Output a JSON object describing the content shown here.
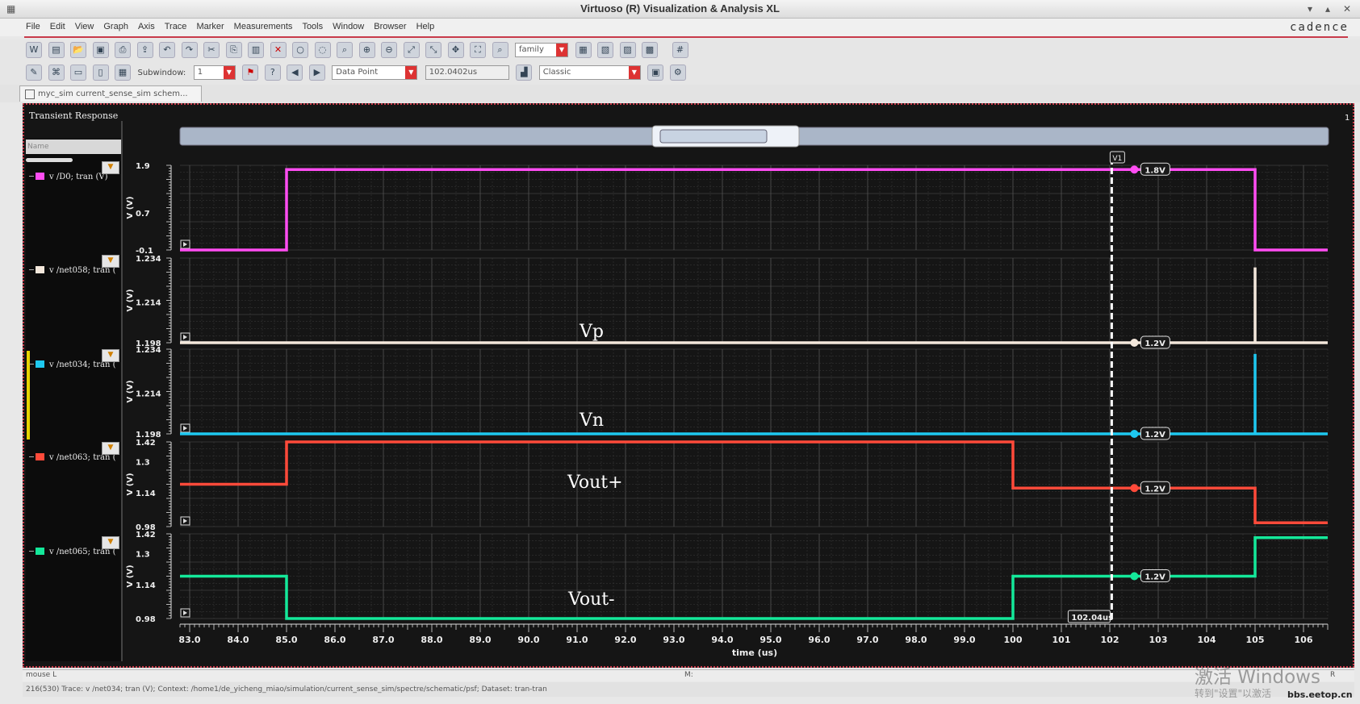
{
  "window": {
    "title": "Virtuoso (R) Visualization & Analysis XL",
    "brand": "cadence"
  },
  "menu": [
    "File",
    "Edit",
    "View",
    "Graph",
    "Axis",
    "Trace",
    "Marker",
    "Measurements",
    "Tools",
    "Window",
    "Browser",
    "Help"
  ],
  "toolbar": {
    "family_combo": "family",
    "subwindow_label": "Subwindow:",
    "subwindow_value": "1",
    "marker_mode": "Data Point",
    "marker_value": "102.0402us",
    "style": "Classic"
  },
  "tab": {
    "label": "myc_sim current_sense_sim schem..."
  },
  "panel": {
    "title": "Transient Response",
    "name_header": "Name",
    "corner_number": "1"
  },
  "status": {
    "mouse": "mouse L",
    "middle": "M:",
    "right": "R",
    "line": "216(530)   Trace: v /net034; tran (V); Context: /home1/de_yicheng_miao/simulation/current_sense_sim/spectre/schematic/psf; Dataset: tran-tran"
  },
  "watermark": {
    "line1": "激活 Windows",
    "line2": "转到\"设置\"以激活",
    "site": "bbs.eetop.cn"
  },
  "colors": {
    "d0": "#ff4df2",
    "net058": "#f4e8dc",
    "net034": "#1ec8f0",
    "net063": "#ff4a3a",
    "net065": "#14e89a"
  },
  "chart_data": {
    "type": "line",
    "xlabel": "time (us)",
    "xlim": [
      82.8,
      106.5
    ],
    "xticks": [
      "83.0",
      "84.0",
      "85.0",
      "86.0",
      "87.0",
      "88.0",
      "89.0",
      "90.0",
      "91.0",
      "92.0",
      "93.0",
      "94.0",
      "95.0",
      "96.0",
      "97.0",
      "98.0",
      "99.0",
      "100",
      "101",
      "102",
      "103",
      "104",
      "105",
      "106"
    ],
    "marker": {
      "x": 102.04,
      "label": "V1",
      "readout": "102.04us"
    },
    "strips": [
      {
        "legend": "v /D0; tran (V)",
        "ylabel": "V (V)",
        "yticks": [
          "1.9",
          "0.7",
          "-0.1"
        ],
        "ylim": [
          -0.1,
          1.9
        ],
        "color": "#ff4df2",
        "marker_value": "1.8V",
        "annotation": "",
        "x": [
          82.8,
          85.0,
          85.0,
          105.0,
          105.0,
          106.5
        ],
        "y": [
          -0.1,
          -0.1,
          1.8,
          1.8,
          -0.1,
          -0.1
        ]
      },
      {
        "legend": "v /net058; tran (",
        "ylabel": "V (V)",
        "yticks": [
          "1.234",
          "1.214",
          "1.198"
        ],
        "ylim": [
          1.198,
          1.234
        ],
        "color": "#f4e8dc",
        "marker_value": "1.2V",
        "annotation": "Vp",
        "x": [
          82.8,
          105.0,
          105.0,
          105.0,
          106.5
        ],
        "y": [
          1.198,
          1.198,
          1.23,
          1.198,
          1.198
        ]
      },
      {
        "legend": "v /net034; tran (",
        "ylabel": "V (V)",
        "yticks": [
          "1.234",
          "1.214",
          "1.198"
        ],
        "ylim": [
          1.198,
          1.234
        ],
        "color": "#1ec8f0",
        "marker_value": "1.2V",
        "annotation": "Vn",
        "x": [
          82.8,
          105.0,
          105.0,
          105.0,
          106.5
        ],
        "y": [
          1.198,
          1.198,
          1.232,
          1.198,
          1.198
        ]
      },
      {
        "legend": "v /net063; tran (",
        "ylabel": "V (V)",
        "yticks": [
          "1.42",
          "1.3",
          "1.14",
          "0.98"
        ],
        "ylim": [
          0.98,
          1.42
        ],
        "color": "#ff4a3a",
        "marker_value": "1.2V",
        "annotation": "Vout+",
        "x": [
          82.8,
          85.0,
          85.0,
          100.0,
          100.0,
          105.0,
          105.0,
          106.5
        ],
        "y": [
          1.2,
          1.2,
          1.42,
          1.42,
          1.18,
          1.18,
          1.0,
          1.0
        ]
      },
      {
        "legend": "v /net065; tran (",
        "ylabel": "V (V)",
        "yticks": [
          "1.42",
          "1.3",
          "1.14",
          "0.98"
        ],
        "ylim": [
          0.98,
          1.42
        ],
        "color": "#14e89a",
        "marker_value": "1.2V",
        "annotation": "Vout-",
        "x": [
          82.8,
          85.0,
          85.0,
          100.0,
          100.0,
          105.0,
          105.0,
          106.5
        ],
        "y": [
          1.2,
          1.2,
          0.98,
          0.98,
          1.2,
          1.2,
          1.4,
          1.4
        ]
      }
    ]
  }
}
